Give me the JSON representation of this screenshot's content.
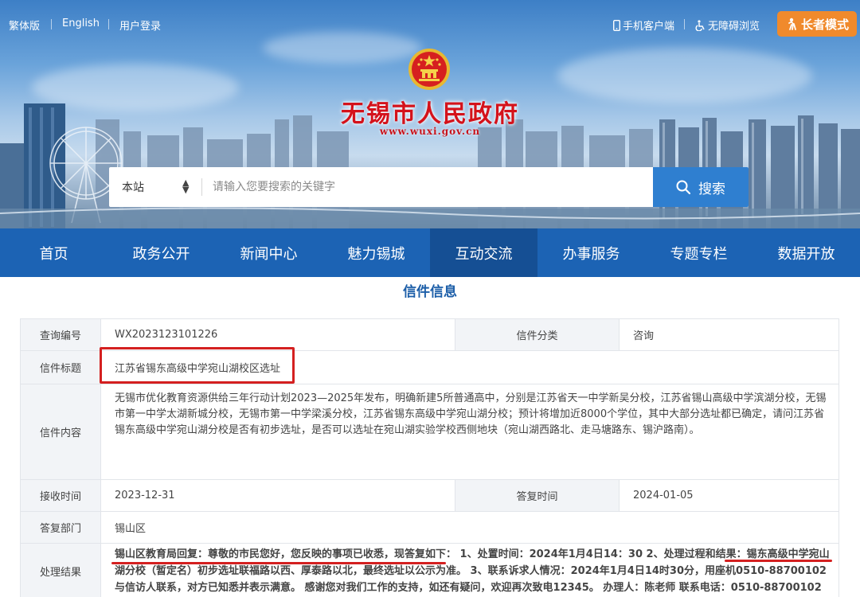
{
  "topbar": {
    "traditional": "繁体版",
    "english": "English",
    "login": "用户登录",
    "mobile": "手机客户端",
    "accessibility": "无障碍浏览",
    "elder_mode": "长者模式"
  },
  "site": {
    "title": "无锡市人民政府",
    "url": "www.wuxi.gov.cn"
  },
  "search": {
    "scope": "本站",
    "placeholder": "请输入您要搜索的关键字",
    "button": "搜索"
  },
  "nav": {
    "items": [
      {
        "label": "首页"
      },
      {
        "label": "政务公开"
      },
      {
        "label": "新闻中心"
      },
      {
        "label": "魅力锡城"
      },
      {
        "label": "互动交流"
      },
      {
        "label": "办事服务"
      },
      {
        "label": "专题专栏"
      },
      {
        "label": "数据开放"
      }
    ],
    "active_index": 4
  },
  "letter": {
    "heading": "信件信息",
    "query_no_label": "查询编号",
    "query_no": "WX2023123101226",
    "category_label": "信件分类",
    "category": "咨询",
    "title_label": "信件标题",
    "title": "江苏省锡东高级中学宛山湖校区选址",
    "content_label": "信件内容",
    "content": "无锡市优化教育资源供给三年行动计划2023—2025年发布，明确新建5所普通高中，分别是江苏省天一中学新吴分校，江苏省锡山高级中学滨湖分校，无锡市第一中学太湖新城分校，无锡市第一中学梁溪分校，江苏省锡东高级中学宛山湖分校；预计将增加近8000个学位，其中大部分选址都已确定，请问江苏省锡东高级中学宛山湖分校是否有初步选址，是否可以选址在宛山湖实验学校西侧地块（宛山湖西路北、走马塘路东、锡沪路南）。",
    "received_label": "接收时间",
    "received": "2023-12-31",
    "replied_label": "答复时间",
    "replied": "2024-01-05",
    "dept_label": "答复部门",
    "dept": "锡山区",
    "result_label": "处理结果",
    "result": "锡山区教育局回复：尊敬的市民您好，您反映的事项已收悉，现答复如下： 1、处置时间：2024年1月4日14：30 2、处理过程和结果：锡东高级中学宛山湖分校（暂定名）初步选址联福路以西、厚泰路以北，最终选址以公示为准。 3、联系诉求人情况：2024年1月4日14时30分，用座机0510-88700102与信访人联系，对方已知悉并表示满意。 感谢您对我们工作的支持，如还有疑问，欢迎再次致电12345。 办理人：陈老师 联系电话：0510-88700102"
  },
  "colors": {
    "nav_bg": "#1c63b4",
    "nav_active": "#154f94",
    "search_btn": "#2f7fd0",
    "elder_btn": "#f08a2c",
    "title_red": "#d4121b",
    "annotation_red": "#d42020"
  }
}
